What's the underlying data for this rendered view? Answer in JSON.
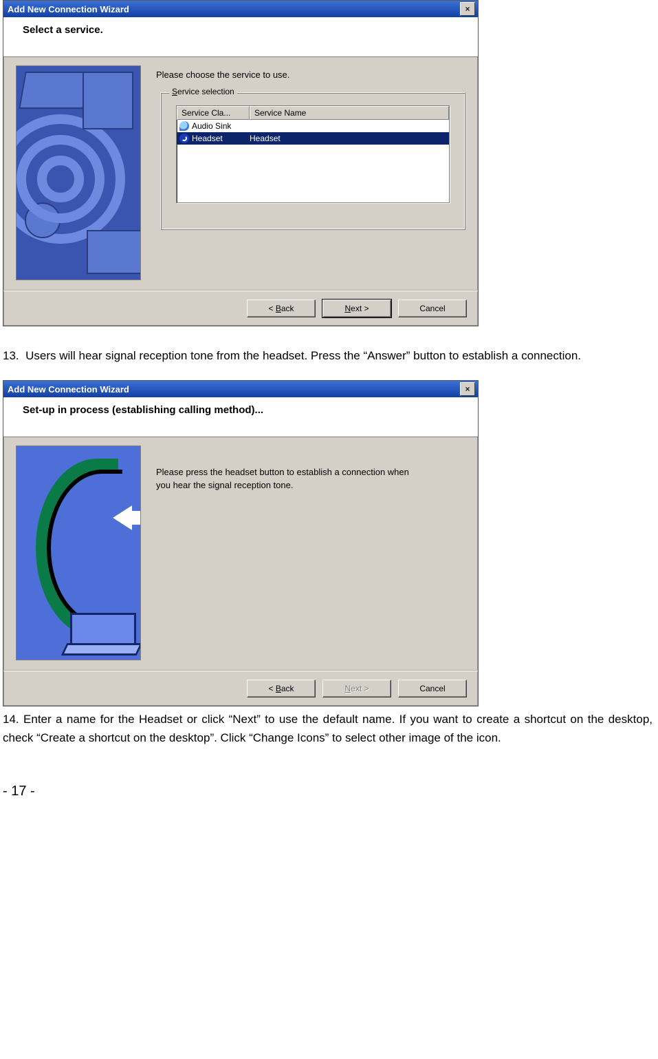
{
  "dialog1": {
    "title": "Add New Connection Wizard",
    "heading": "Select a service.",
    "prompt": "Please choose the service to use.",
    "group_legend": "Service selection",
    "col_class": "Service Cla...",
    "col_name": "Service Name",
    "rows": [
      {
        "cls": "Audio Sink",
        "name": ""
      },
      {
        "cls": "Headset",
        "name": "Headset"
      }
    ],
    "btn_back": "< Back",
    "btn_next": "Next >",
    "btn_cancel": "Cancel"
  },
  "step13": {
    "num": "13.",
    "text": "Users will hear signal reception tone from the headset. Press the “Answer” button to establish a connection."
  },
  "dialog2": {
    "title": "Add New Connection Wizard",
    "heading": "Set-up in process (establishing calling method)...",
    "message": "Please press the headset button to establish a connection when you hear the signal reception tone.",
    "btn_back": "< Back",
    "btn_next": "Next >",
    "btn_cancel": "Cancel"
  },
  "step14": {
    "num": "14.",
    "text": "Enter a name for the Headset or click “Next” to use the default name. If you want to create a shortcut on the desktop, check “Create a shortcut on the desktop”. Click “Change Icons” to select other image of the icon."
  },
  "page_number": "- 17 -"
}
